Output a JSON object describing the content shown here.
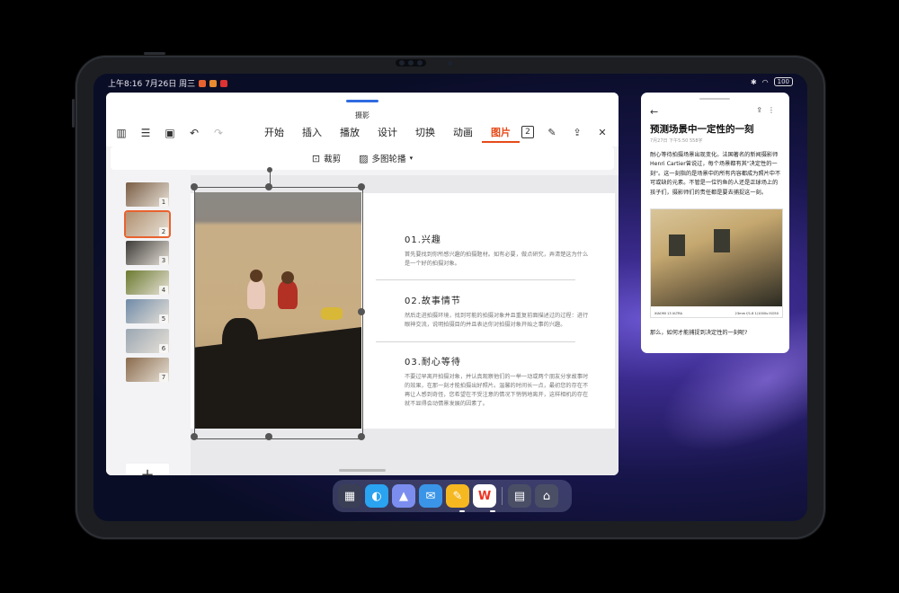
{
  "status_bar": {
    "time_date": "上午8:16 7月26日 周三",
    "battery": "100"
  },
  "main_window": {
    "title": "摄影",
    "menu": [
      "开始",
      "插入",
      "播放",
      "设计",
      "切换",
      "动画",
      "图片"
    ],
    "active_menu": "图片",
    "page_count_badge": "2",
    "subtoolbar": {
      "crop": "裁剪",
      "multi_carousel": "多图轮播"
    },
    "slides": [
      {
        "n": "1",
        "color": "#7a5d45"
      },
      {
        "n": "2",
        "color": "#b09070"
      },
      {
        "n": "3",
        "color": "#3c3a38"
      },
      {
        "n": "4",
        "color": "#6b7a2f"
      },
      {
        "n": "5",
        "color": "#6f8aa8"
      },
      {
        "n": "6",
        "color": "#9aa6b2"
      },
      {
        "n": "7",
        "color": "#8a6a4c"
      }
    ],
    "add_slide": "+",
    "sections": [
      {
        "title": "01.兴趣",
        "text": "首先要找到你所感兴趣的拍摄题材。如有必要，做点研究，弄清楚这为什么是一个好的拍摄对象。"
      },
      {
        "title": "02.故事情节",
        "text": "然后走进拍摄环境，找到可能的拍摄对象并且重复前面描述过的过程：进行眼神交流，说明拍摄目的并且表达你对拍摄对象开始之事的兴趣。"
      },
      {
        "title": "03.耐心等待",
        "text": "不要过早离开拍摄对象，并认真观察他们的一举一动或两个朋友分享故事时的效果，在那一刻才能拍摄出好照片。温馨的时间长一点，最初您的存在不再让人感到奇怪，您希望在不受注意的情况下悄悄地离开，这样相机的存在就不显得会动情景发展的因素了。"
      }
    ]
  },
  "side_window": {
    "title": "预测场景中一定性的一刻",
    "meta": "7月27日 下午5:50    558字",
    "body": "耐心等待拍摄场景出现变化。法国著名的新闻摄影师Henri Cartier曾说过，每个场景都有其\"决定性的一刻\"。这一刻指的是场景中的所有内容都成为照片中不可或缺的元素。不管是一位钓鱼的人还是正球场上的孩子们，摄影师们的责任都是要去捕捉这一刻。",
    "caption_left": "XIAOMI 13 ULTRA",
    "caption_right": "23mm f/1.8 1/1000s ISO50",
    "question": "那么，如何才能捕捉到决定性的一刻呢?"
  },
  "dock": {
    "apps": [
      {
        "name": "app-grid",
        "glyph": "▦",
        "color": "#3b3f55"
      },
      {
        "name": "browser",
        "glyph": "◐",
        "color": "#2aa3f0"
      },
      {
        "name": "gallery",
        "glyph": "▲",
        "color": "#7b8ef0"
      },
      {
        "name": "mail",
        "glyph": "✉",
        "color": "#3a95e8"
      },
      {
        "name": "notes",
        "glyph": "✎",
        "color": "#f6b821"
      },
      {
        "name": "wps-office",
        "glyph": "W",
        "color": "#ffffff"
      },
      {
        "name": "multi-window",
        "glyph": "▤",
        "color": "#4a4f66"
      },
      {
        "name": "home",
        "glyph": "⌂",
        "color": "#4a4f66"
      }
    ]
  }
}
